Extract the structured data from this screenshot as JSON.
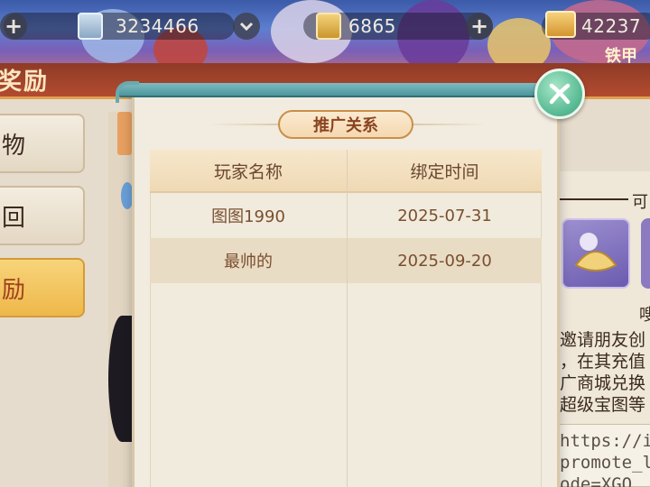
{
  "top_bar": {
    "resource_1": {
      "value": "3234466",
      "icon": "silver-coin-icon"
    },
    "resource_2": {
      "value": "6865",
      "icon": "gold-ingot-icon"
    },
    "resource_3": {
      "value": "42237",
      "icon": "treasure-chest-icon"
    },
    "add_symbol": "+",
    "corner_text": "铁甲"
  },
  "panel": {
    "title": "奖励",
    "tabs": [
      {
        "label": "物"
      },
      {
        "label": "回"
      },
      {
        "label": "励"
      }
    ],
    "right_header": "可",
    "right_label": "嗖",
    "right_desc": [
      "邀请朋友创",
      "，在其充值",
      "广商城兑换",
      "超级宝图等"
    ],
    "url_lines": [
      "https://id",
      "promote_l",
      "ode=XGO"
    ]
  },
  "modal": {
    "title": "推广关系",
    "columns": [
      "玩家名称",
      "绑定时间"
    ],
    "rows": [
      {
        "name": "图图1990",
        "date": "2025-07-31"
      },
      {
        "name": "最帅的",
        "date": "2025-09-20"
      }
    ],
    "close_icon": "close-icon"
  },
  "colors": {
    "accent": "#c98f4a",
    "title_text": "#8a4420",
    "cell_text": "#7a4f30",
    "close_button": "#5fbf98"
  }
}
